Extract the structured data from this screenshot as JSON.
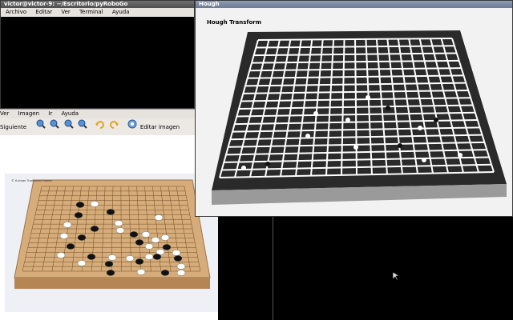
{
  "terminal": {
    "title": "victor@victor-9: ~/Escritorio/pyRoboGo",
    "menu": [
      "Archivo",
      "Editar",
      "Ver",
      "Terminal",
      "Ayuda"
    ]
  },
  "image_viewer": {
    "menu": [
      "Ver",
      "Imagen",
      "Ir",
      "Ayuda"
    ],
    "toolbar": {
      "next_label": "Siguiente",
      "edit_label": "Editar imagen"
    },
    "photo_caption": "© Yucheer Traditional Games"
  },
  "hough": {
    "title": "Hough",
    "overlay_text": "Hough Transform"
  },
  "colors": {
    "title_bg": "#5a5a5a",
    "menu_bg": "#e6e3df",
    "board_wood": "#d6ad7a",
    "terminal_bg": "#000000"
  },
  "icons": [
    "zoom-in-icon",
    "zoom-out-icon",
    "zoom-fit-icon",
    "zoom-normal-icon",
    "rotate-left-icon",
    "rotate-right-icon",
    "edit-image-icon"
  ]
}
